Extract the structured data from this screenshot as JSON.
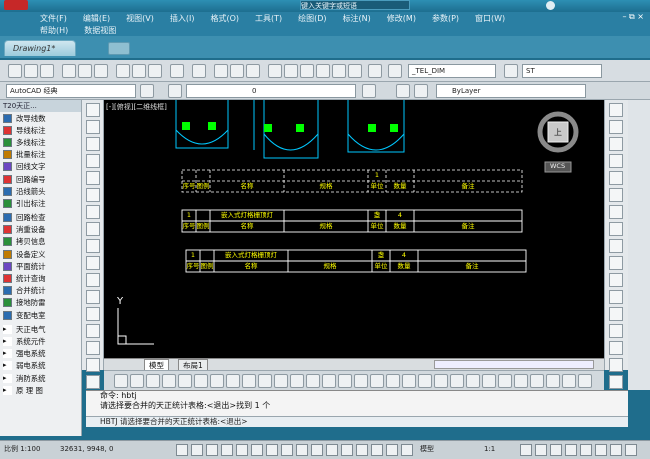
{
  "app": {
    "title": "键入关键字或短语",
    "window_controls": "– ⧉ ×"
  },
  "menus": {
    "row1": [
      "文件(F)",
      "编辑(E)",
      "视图(V)",
      "插入(I)",
      "格式(O)",
      "工具(T)",
      "绘图(D)",
      "标注(N)",
      "修改(M)",
      "参数(P)",
      "窗口(W)"
    ],
    "row2": [
      "帮助(H)",
      "数据视图"
    ]
  },
  "tabs": {
    "document": "Drawing1*"
  },
  "toolbars": {
    "textstyle_combo": "_TEL_DIM",
    "workspace_combo": "AutoCAD 经典",
    "layer_combo": "0",
    "color_combo": "ByLayer",
    "misc_combo": "ST"
  },
  "palette": {
    "title": "T20天正...",
    "items": [
      "改导线数",
      "导线标注",
      "多线标注",
      "批量标注",
      "回线文字",
      "回路编号",
      "沿线箭头",
      "引出标注",
      "回路检查",
      "消重设备",
      "拷贝信息",
      "设备定义",
      "平面统计",
      "统计查询",
      "合并统计",
      "接地防雷",
      "变配电室",
      "天正电气",
      "系统元件",
      "强电系统",
      "弱电系统",
      "消防系统",
      "原 理 图"
    ]
  },
  "canvas": {
    "viewport_label": "[-][俯视][二维线框]",
    "wcs_label": "WCS",
    "compass_top": "上",
    "y_axis": "Y",
    "dashed_table": {
      "row1": [
        "",
        "",
        "",
        "",
        "1",
        "",
        ""
      ],
      "row2": [
        "序号",
        "图例",
        "名称",
        "规格",
        "单位",
        "数量",
        "备注"
      ]
    },
    "table2": {
      "row1": [
        "1",
        "",
        "嵌入式灯格栅顶灯",
        "",
        "盏",
        "4",
        ""
      ],
      "row2": [
        "序号",
        "图例",
        "名称",
        "规格",
        "单位",
        "数量",
        "备注"
      ]
    },
    "table3": {
      "row1": [
        "1",
        "",
        "嵌入式灯格栅顶灯",
        "",
        "盏",
        "4",
        ""
      ],
      "row2": [
        "序号",
        "图例",
        "名称",
        "规格",
        "单位",
        "数量",
        "备注"
      ]
    }
  },
  "layout_tabs": [
    "模型",
    "布局1"
  ],
  "command": {
    "line1": "命令: hbtj",
    "line2": "请选择要合并的天正统计表格:<退出>找到 1 个",
    "input": "HBTJ 请选择要合并的天正统计表格:<退出>"
  },
  "status": {
    "scale": "比例 1:100",
    "coords": "32631, 9948, 0",
    "model": "模型",
    "annotation_scale": "1:1"
  },
  "colors": {
    "titlebar": "#2d8fb3",
    "canvas": "#000000",
    "cad_cyan": "#00c8ff",
    "cad_yellow": "#ffff00",
    "cad_green": "#00ff00"
  }
}
